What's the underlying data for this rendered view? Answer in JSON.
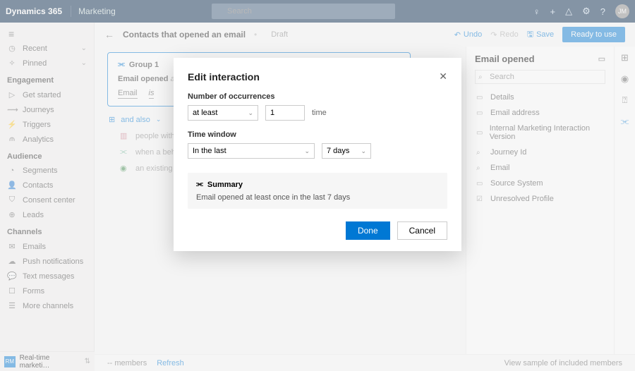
{
  "topbar": {
    "brand": "Dynamics 365",
    "module": "Marketing",
    "search_placeholder": "Search",
    "avatar_initials": "JM"
  },
  "sidebar": {
    "recent": "Recent",
    "pinned": "Pinned",
    "sections": [
      {
        "title": "Engagement",
        "items": [
          {
            "icon": "▷",
            "label": "Get started"
          },
          {
            "icon": "⟿",
            "label": "Journeys"
          },
          {
            "icon": "⚡",
            "label": "Triggers"
          },
          {
            "icon": "⫙",
            "label": "Analytics"
          }
        ]
      },
      {
        "title": "Audience",
        "items": [
          {
            "icon": "◔",
            "label": "Segments"
          },
          {
            "icon": "👤",
            "label": "Contacts"
          },
          {
            "icon": "⛉",
            "label": "Consent center"
          },
          {
            "icon": "⊕",
            "label": "Leads"
          }
        ]
      },
      {
        "title": "Channels",
        "items": [
          {
            "icon": "✉",
            "label": "Emails"
          },
          {
            "icon": "☁",
            "label": "Push notifications"
          },
          {
            "icon": "💬",
            "label": "Text messages"
          },
          {
            "icon": "☐",
            "label": "Forms"
          },
          {
            "icon": "☰",
            "label": "More channels"
          }
        ]
      }
    ],
    "app_switcher": "Real-time marketi…"
  },
  "cmdbar": {
    "title": "Contacts that opened an email",
    "status": "Draft",
    "undo": "Undo",
    "redo": "Redo",
    "save": "Save",
    "ready": "Ready to use"
  },
  "canvas": {
    "group_label": "Group 1",
    "interaction_prefix": "Email opened",
    "interaction_suffix": "at l",
    "email_label": "Email",
    "is_label": "is",
    "and_also": "and also",
    "hint_attr": "people with a sp",
    "hint_behavior": "when a behavio",
    "hint_segment": "an existing segm"
  },
  "rightpanel": {
    "title": "Email opened",
    "search_placeholder": "Search",
    "items": [
      "Details",
      "Email address",
      "Internal Marketing Interaction Version",
      "Journey Id",
      "Email",
      "Source System",
      "Unresolved Profile"
    ]
  },
  "footer": {
    "members": "-- members",
    "refresh": "Refresh",
    "sample": "View sample of included members"
  },
  "modal": {
    "title": "Edit interaction",
    "occ_label": "Number of occurrences",
    "occ_operator": "at least",
    "occ_value": "1",
    "occ_unit": "time",
    "tw_label": "Time window",
    "tw_range": "In the last",
    "tw_value": "7 days",
    "summary_head": "Summary",
    "summary_body": "Email opened at least once in the last 7 days",
    "done": "Done",
    "cancel": "Cancel"
  }
}
